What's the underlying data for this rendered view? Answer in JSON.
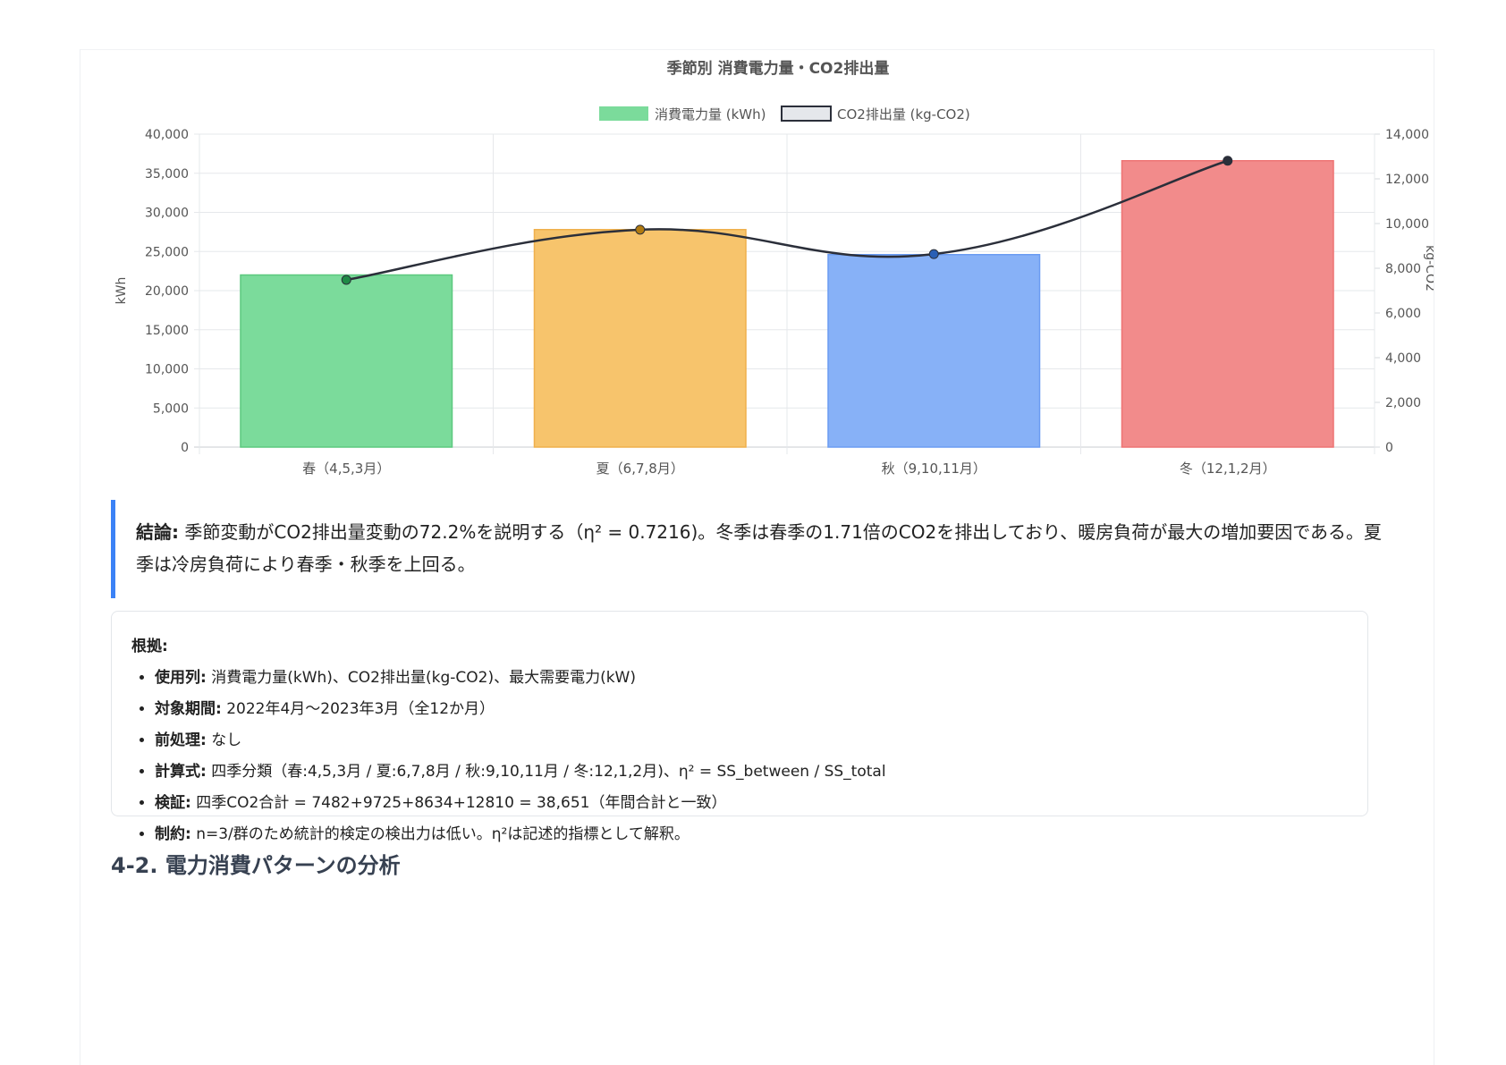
{
  "chart_data": {
    "type": "bar",
    "title": "季節別 消費電力量・CO2排出量",
    "categories": [
      "春（4,5,3月）",
      "夏（6,7,8月）",
      "秋（9,10,11月）",
      "冬（12,1,2月）"
    ],
    "series": [
      {
        "name": "消費電力量 (kWh)",
        "type": "bar",
        "axis": "left",
        "values": [
          22000,
          27800,
          24600,
          36600
        ],
        "colors": [
          "#7bdb9b",
          "#f7c46c",
          "#87b1f7",
          "#f28b8b"
        ],
        "borders": [
          "#5cc97f",
          "#efb04d",
          "#6b9cf2",
          "#ee7474"
        ]
      },
      {
        "name": "CO2排出量 (kg-CO2)",
        "type": "line",
        "axis": "right",
        "values": [
          7482,
          9725,
          8634,
          12810
        ],
        "point_colors": [
          "#1f8a46",
          "#b07a10",
          "#2a5fb5",
          "#2b2f3a"
        ],
        "color": "#2b2f3a"
      }
    ],
    "y_left": {
      "label": "kWh",
      "min": 0,
      "max": 40000,
      "ticks": [
        "0",
        "5,000",
        "10,000",
        "15,000",
        "20,000",
        "25,000",
        "30,000",
        "35,000",
        "40,000"
      ]
    },
    "y_right": {
      "label": "kg-CO2",
      "min": 0,
      "max": 14000,
      "ticks": [
        "0",
        "2,000",
        "4,000",
        "6,000",
        "8,000",
        "10,000",
        "12,000",
        "14,000"
      ]
    },
    "grid": true,
    "legend": "top-center"
  },
  "conclusion": {
    "label": "結論:",
    "text": " 季節変動がCO2排出量変動の72.2%を説明する（η² = 0.7216)。冬季は春季の1.71倍のCO2を排出しており、暖房負荷が最大の増加要因である。夏季は冷房負荷により春季・秋季を上回る。"
  },
  "evidence": {
    "title": "根拠:",
    "items": [
      {
        "label": "使用列:",
        "text": " 消費電力量(kWh)、CO2排出量(kg-CO2)、最大需要電力(kW)"
      },
      {
        "label": "対象期間:",
        "text": " 2022年4月〜2023年3月（全12か月）"
      },
      {
        "label": "前処理:",
        "text": " なし"
      },
      {
        "label": "計算式:",
        "text": " 四季分類（春:4,5,3月 / 夏:6,7,8月 / 秋:9,10,11月 / 冬:12,1,2月)、η² = SS_between / SS_total"
      },
      {
        "label": "検証:",
        "text": " 四季CO2合計 = 7482+9725+8634+12810 = 38,651（年間合計と一致）"
      },
      {
        "label": "制約:",
        "text": " n=3/群のため統計的検定の検出力は低い。η²は記述的指標として解釈。"
      }
    ]
  },
  "section": {
    "title": "4-2. 電力消費パターンの分析"
  }
}
